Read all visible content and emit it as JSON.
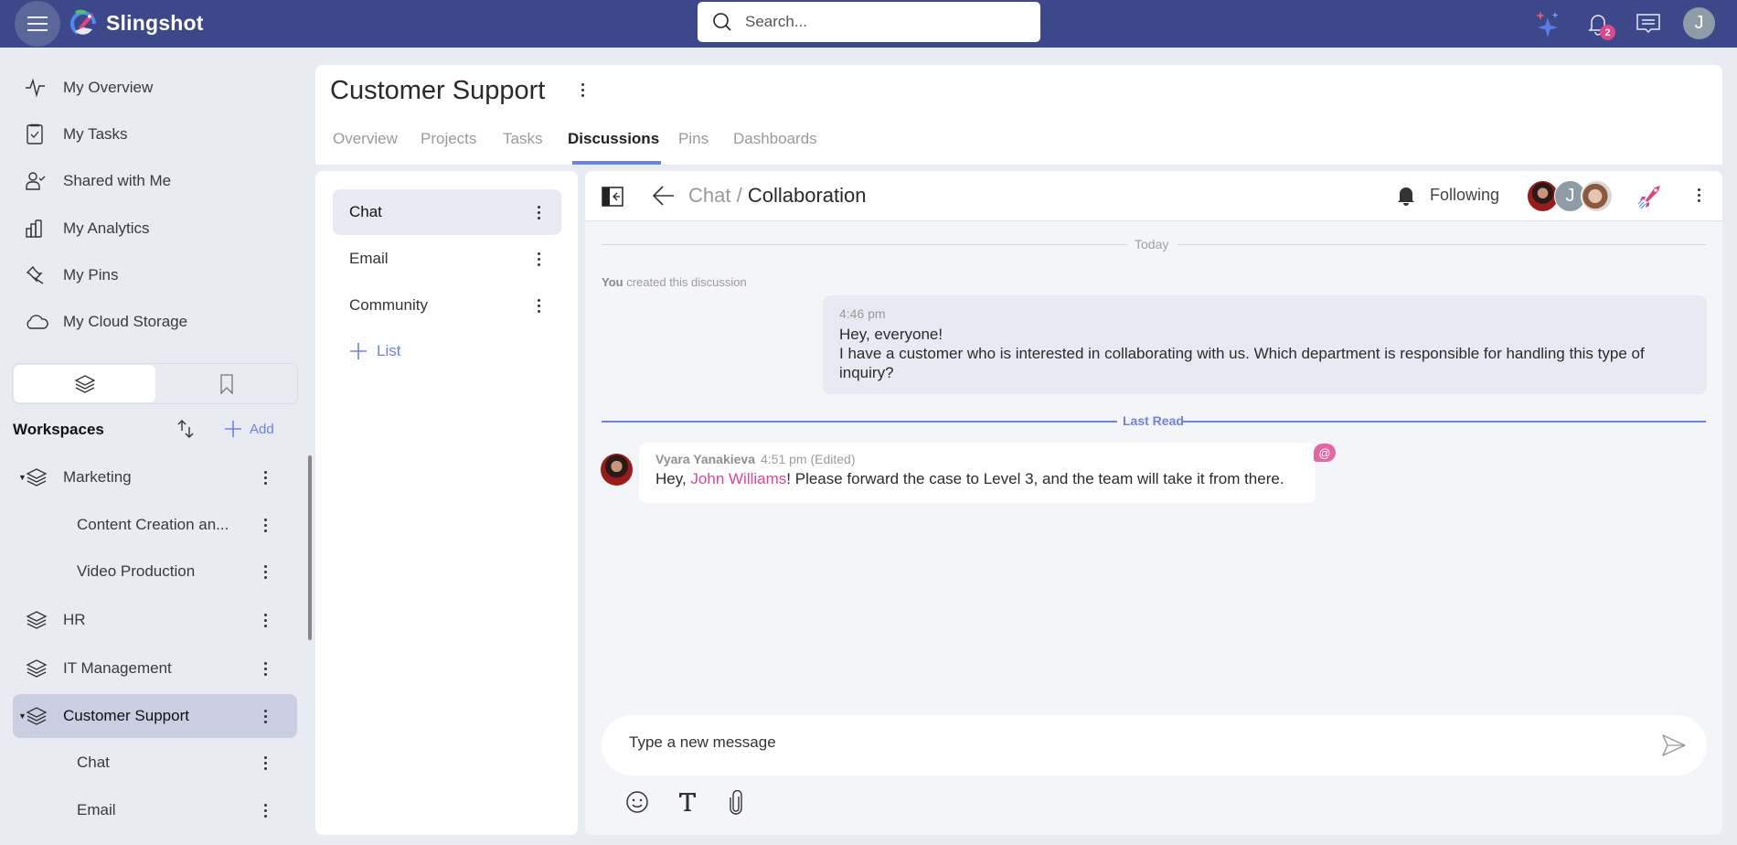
{
  "app": {
    "name": "Slingshot",
    "search_placeholder": "Search...",
    "notifications_count": "2",
    "user_initial": "J"
  },
  "sidebar": {
    "nav": [
      {
        "label": "My Overview",
        "icon": "activity-icon"
      },
      {
        "label": "My Tasks",
        "icon": "clipboard-check-icon"
      },
      {
        "label": "Shared with Me",
        "icon": "user-check-icon"
      },
      {
        "label": "My Analytics",
        "icon": "bar-chart-icon"
      },
      {
        "label": "My Pins",
        "icon": "pin-icon"
      },
      {
        "label": "My Cloud Storage",
        "icon": "cloud-icon"
      }
    ],
    "segments": [
      {
        "name": "workspaces",
        "icon": "layers-icon",
        "active": true
      },
      {
        "name": "bookmarks",
        "icon": "bookmark-icon",
        "active": false
      }
    ],
    "workspaces_title": "Workspaces",
    "add_label": "Add",
    "tree": [
      {
        "label": "Marketing",
        "level": 0,
        "expanded": true
      },
      {
        "label": "Content Creation an...",
        "level": 1
      },
      {
        "label": "Video Production",
        "level": 1
      },
      {
        "label": "HR",
        "level": 0
      },
      {
        "label": "IT Management",
        "level": 0
      },
      {
        "label": "Customer Support",
        "level": 0,
        "expanded": true,
        "selected": true
      },
      {
        "label": "Chat",
        "level": 1
      },
      {
        "label": "Email",
        "level": 1
      }
    ]
  },
  "workspace": {
    "title": "Customer Support",
    "tabs": [
      {
        "label": "Overview"
      },
      {
        "label": "Projects"
      },
      {
        "label": "Tasks"
      },
      {
        "label": "Discussions",
        "active": true
      },
      {
        "label": "Pins"
      },
      {
        "label": "Dashboards"
      }
    ]
  },
  "lists": {
    "items": [
      {
        "label": "Chat",
        "selected": true
      },
      {
        "label": "Email"
      },
      {
        "label": "Community"
      }
    ],
    "add_label": "List"
  },
  "discussion": {
    "breadcrumb_parent": "Chat",
    "breadcrumb_sep": "/",
    "title": "Collaboration",
    "follow_label": "Following",
    "member_initial": "J",
    "day_separator": "Today",
    "created_actor": "You",
    "created_text": "created this discussion",
    "last_read_label": "Last Read",
    "messages": [
      {
        "own": true,
        "time": "4:46 pm",
        "text": "Hey, everyone!\nI have a customer who is interested in collaborating with us. Which department is responsible for handling this type of inquiry?"
      },
      {
        "own": false,
        "author": "Vyara Yanakieva",
        "time": "4:51 pm",
        "edited": "(Edited)",
        "text_before": "Hey, ",
        "mention": "John Williams",
        "text_after": "! Please forward the case to Level 3, and the team will take it from there.",
        "mention_badge": "@"
      }
    ],
    "composer_placeholder": "Type a new message"
  },
  "colors": {
    "header_bg": "#3c4889",
    "accent": "#6b82e6",
    "mention": "#e0458d"
  }
}
